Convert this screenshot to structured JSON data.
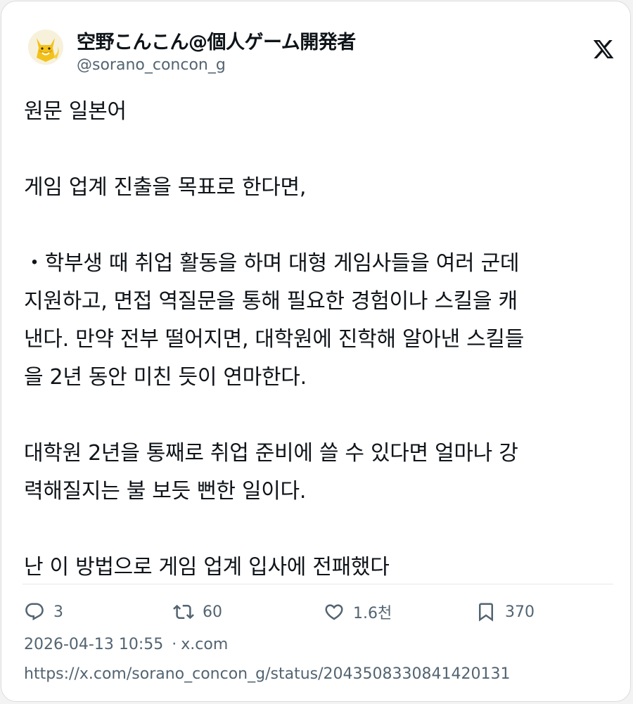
{
  "author": {
    "display_name": "空野こんこん@個人ゲーム開発者",
    "handle": "@sorano_concon_g",
    "avatar_icon": "fox-avatar-icon"
  },
  "brand": {
    "logo_icon": "x-logo-icon"
  },
  "tweet": {
    "lines": [
      "원문 일본어",
      "",
      "게임 업계 진출을 목표로 한다면,",
      "",
      "・학부생 때 취업 활동을 하며 대형 게임사들을 여러 군데",
      "지원하고, 면접 역질문을 통해 필요한 경험이나 스킬을 캐",
      "낸다. 만약 전부 떨어지면, 대학원에 진학해 알아낸 스킬들",
      "을 2년 동안 미친 듯이 연마한다.",
      "",
      "대학원 2년을 통째로 취업 준비에 쓸 수 있다면 얼마나 강",
      "력해질지는 불 보듯 뻔한 일이다.",
      "",
      "난 이 방법으로 게임 업계 입사에 전패했다"
    ]
  },
  "actions": {
    "replies": "3",
    "reposts": "60",
    "likes": "1.6천",
    "bookmarks": "370"
  },
  "meta": {
    "timestamp": "2026-04-13 10:55",
    "separator": "·",
    "source": "x.com",
    "url": "https://x.com/sorano_concon_g/status/2043508330841420131"
  },
  "colors": {
    "text": "#0f1419",
    "muted": "#536471",
    "avatar_fox": "#f2c21b"
  }
}
